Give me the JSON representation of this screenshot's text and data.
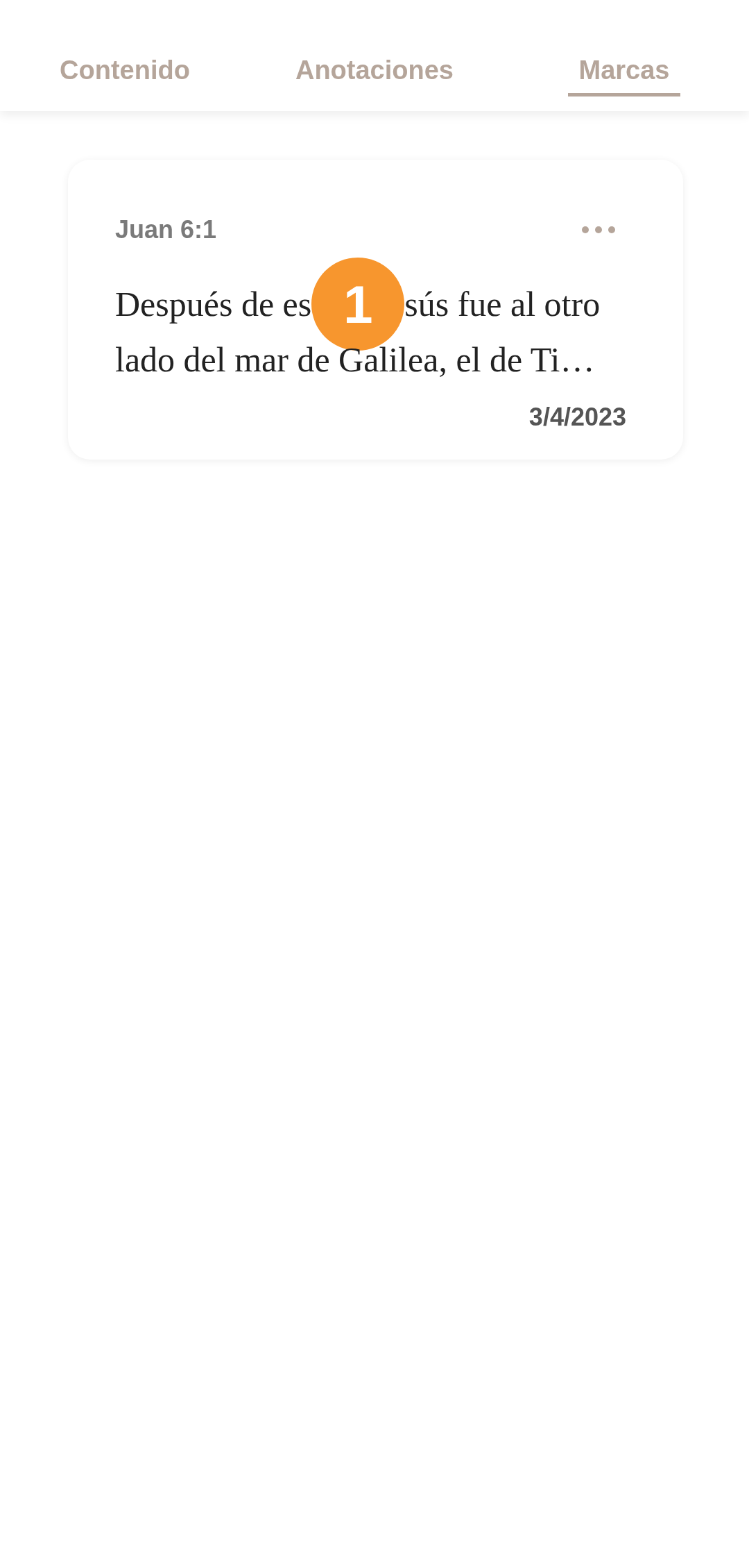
{
  "tabs": [
    {
      "label": "Contenido",
      "selected": false
    },
    {
      "label": "Anotaciones",
      "selected": false
    },
    {
      "label": "Marcas",
      "selected": true
    }
  ],
  "bookmarks": [
    {
      "reference": "Juan 6:1",
      "lines": [
        [
          "Después de es",
          "sús fue al otro"
        ],
        [
          "lado del mar de Galilea, el de Ti…"
        ]
      ],
      "date": "3/4/2023"
    }
  ],
  "badge": "1"
}
